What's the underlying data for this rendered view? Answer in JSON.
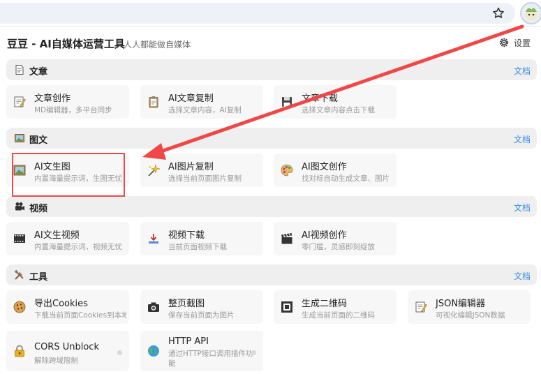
{
  "header": {
    "title": "豆豆 - AI自媒体运营工具",
    "subtitle": "人人都能做自媒体",
    "settings_label": "设置"
  },
  "sections": [
    {
      "name": "文章",
      "doc": "文档",
      "cards": [
        {
          "name": "文章创作",
          "desc": "MD编辑器，多平台同步",
          "icon": "edit-icon"
        },
        {
          "name": "AI文章复制",
          "desc": "选择文章内容，AI复制",
          "icon": "clipboard-icon"
        },
        {
          "name": "文章下载",
          "desc": "选择文章内容点击下载",
          "icon": "floppy-icon"
        }
      ]
    },
    {
      "name": "图文",
      "doc": "文档",
      "cards": [
        {
          "name": "AI文生图",
          "desc": "内置海量提示词，生图无忧",
          "icon": "picture-icon"
        },
        {
          "name": "AI图片复制",
          "desc": "选择当前页面图片复制",
          "icon": "sparkle-icon"
        },
        {
          "name": "AI图文创作",
          "desc": "找对标自动生成文章、图片",
          "icon": "palette-icon"
        }
      ]
    },
    {
      "name": "视频",
      "doc": "文档",
      "cards": [
        {
          "name": "AI文生视频",
          "desc": "内置海量提示词，视频无忧",
          "icon": "film-icon"
        },
        {
          "name": "视频下载",
          "desc": "当前页面视频下载",
          "icon": "download-icon"
        },
        {
          "name": "AI视频创作",
          "desc": "零门槛，灵感即刻绽放",
          "icon": "clapper-icon"
        }
      ]
    },
    {
      "name": "工具",
      "doc": "文档",
      "cards": [
        {
          "name": "导出Cookies",
          "desc": "下载当前页面Cookies到本地",
          "icon": "cookie-icon"
        },
        {
          "name": "整页截图",
          "desc": "保存当前页面为图片",
          "icon": "camera-icon"
        },
        {
          "name": "生成二维码",
          "desc": "生成当前页面的二维码",
          "icon": "qrcode-icon"
        },
        {
          "name": "JSON编辑器",
          "desc": "可视化编辑JSON数据",
          "icon": "json-edit-icon"
        },
        {
          "name": "CORS Unblock",
          "desc": "解除跨域限制",
          "icon": "lock-icon"
        },
        {
          "name": "HTTP API",
          "desc": "通过HTTP接口调用插件功能",
          "icon": "globe-icon"
        }
      ]
    }
  ],
  "colors": {
    "accent": "#3a8ee6",
    "highlight": "#f04848"
  }
}
